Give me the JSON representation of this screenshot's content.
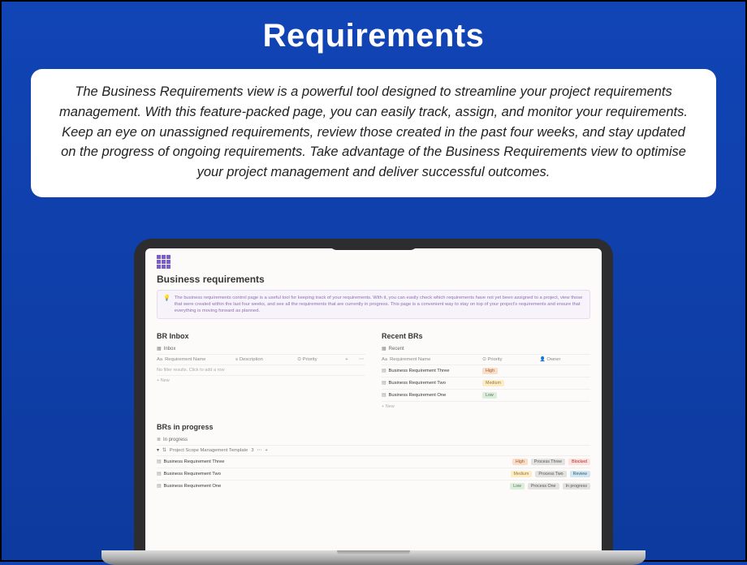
{
  "title": "Requirements",
  "intro": "The Business Requirements view is a powerful tool designed to streamline your project requirements management. With this feature-packed page, you can easily track, assign, and monitor your requirements. Keep an eye on unassigned requirements, review those created in the past four weeks, and stay updated on the progress of ongoing requirements. Take advantage of the Business Requirements view to optimise your project management and deliver successful outcomes.",
  "app": {
    "page_title": "Business requirements",
    "callout": "The business requirements control page is a useful tool for keeping track of your requirements. With it, you can easily check which requirements have not yet been assigned to a project, view those that were created within the last four weeks, and see all the requirements that are currently in progress. This page is a convenient way to stay on top of your project's requirements and ensure that everything is moving forward as planned.",
    "inbox": {
      "heading": "BR Inbox",
      "tab": "Inbox",
      "cols": {
        "name": "Requirement Name",
        "desc": "Description",
        "prio": "Priority"
      },
      "empty": "No filter results. Click to add a row",
      "new": "+ New"
    },
    "recent": {
      "heading": "Recent BRs",
      "tab": "Recent",
      "cols": {
        "name": "Requirement Name",
        "prio": "Priority",
        "owner": "Owner"
      },
      "rows": [
        {
          "name": "Business Requirement Three",
          "prio": "High",
          "prio_cls": "b-high"
        },
        {
          "name": "Business Requirement Two",
          "prio": "Medium",
          "prio_cls": "b-med"
        },
        {
          "name": "Business Requirement One",
          "prio": "Low",
          "prio_cls": "b-low"
        }
      ],
      "new": "+ New"
    },
    "inprog": {
      "heading": "BRs in progress",
      "tab": "In progress",
      "group": "Project Scope Management Template",
      "group_count": "3",
      "rows": [
        {
          "name": "Business Requirement Three",
          "prio": "High",
          "prio_cls": "b-high",
          "proc": "Process Three",
          "stat": "Blocked",
          "stat_cls": "b-blk"
        },
        {
          "name": "Business Requirement Two",
          "prio": "Medium",
          "prio_cls": "b-med",
          "proc": "Process Two",
          "stat": "Review",
          "stat_cls": "b-rev"
        },
        {
          "name": "Business Requirement One",
          "prio": "Low",
          "prio_cls": "b-low",
          "proc": "Process One",
          "stat": "In progress",
          "stat_cls": "b-prog"
        }
      ]
    }
  }
}
